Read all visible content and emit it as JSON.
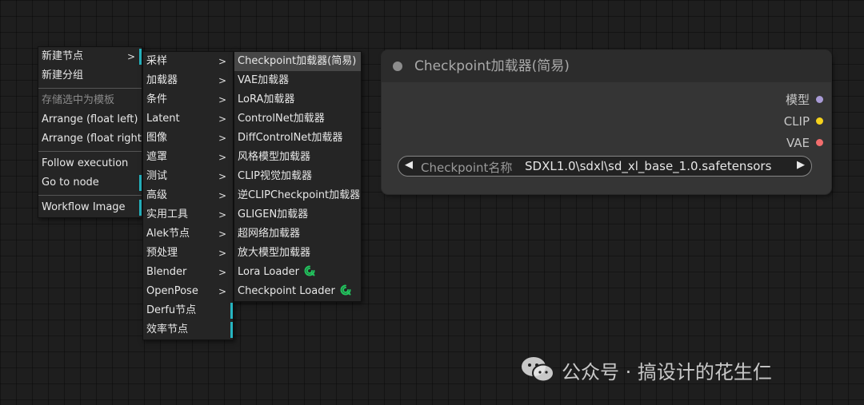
{
  "menu1": {
    "items": [
      {
        "label": "新建节点",
        "submenu": true,
        "arrow": ">"
      },
      {
        "label": "新建分组"
      },
      {
        "label": "存储选中为模板",
        "disabled": true
      },
      {
        "label": "Arrange (float left)"
      },
      {
        "label": "Arrange (float right)"
      },
      {
        "label": "Follow execution"
      },
      {
        "label": "Go to node",
        "submenu": true
      },
      {
        "label": "Workflow Image",
        "submenu": true
      }
    ]
  },
  "menu2": {
    "items": [
      {
        "label": "采样"
      },
      {
        "label": "加载器"
      },
      {
        "label": "条件"
      },
      {
        "label": "Latent"
      },
      {
        "label": "图像"
      },
      {
        "label": "遮罩"
      },
      {
        "label": "测试"
      },
      {
        "label": "高级"
      },
      {
        "label": "实用工具"
      },
      {
        "label": "Alek节点"
      },
      {
        "label": "预处理"
      },
      {
        "label": "Blender"
      },
      {
        "label": "OpenPose"
      },
      {
        "label": "Derfu节点"
      },
      {
        "label": "效率节点"
      }
    ],
    "arrow": ">"
  },
  "menu3": {
    "items": [
      {
        "label": "Checkpoint加载器(简易)"
      },
      {
        "label": "VAE加载器"
      },
      {
        "label": "LoRA加载器"
      },
      {
        "label": "ControlNet加载器"
      },
      {
        "label": "DiffControlNet加载器"
      },
      {
        "label": "风格模型加载器"
      },
      {
        "label": "CLIP视觉加载器"
      },
      {
        "label": "逆CLIPCheckpoint加载器"
      },
      {
        "label": "GLIGEN加载器"
      },
      {
        "label": "超网络加载器"
      },
      {
        "label": "放大模型加载器"
      },
      {
        "label": "Lora Loader"
      },
      {
        "label": "Checkpoint Loader"
      }
    ],
    "link_icon_color": "#22c55e"
  },
  "node": {
    "title": "Checkpoint加载器(简易)",
    "outputs": [
      {
        "label": "模型",
        "color": "#a99bd6"
      },
      {
        "label": "CLIP",
        "color": "#f5d21c"
      },
      {
        "label": "VAE",
        "color": "#f26d6d"
      }
    ],
    "widget": {
      "left_arrow": "◀",
      "label": "Checkpoint名称",
      "value": "SDXL1.0\\sdxl\\sd_xl_base_1.0.safetensors",
      "right_arrow": "▶"
    }
  },
  "watermark": {
    "text": "公众号 · 搞设计的花生仁"
  },
  "colors": {
    "accent": "#26b6c2",
    "canvas": "#1e1e1e",
    "node_body": "#353535"
  }
}
